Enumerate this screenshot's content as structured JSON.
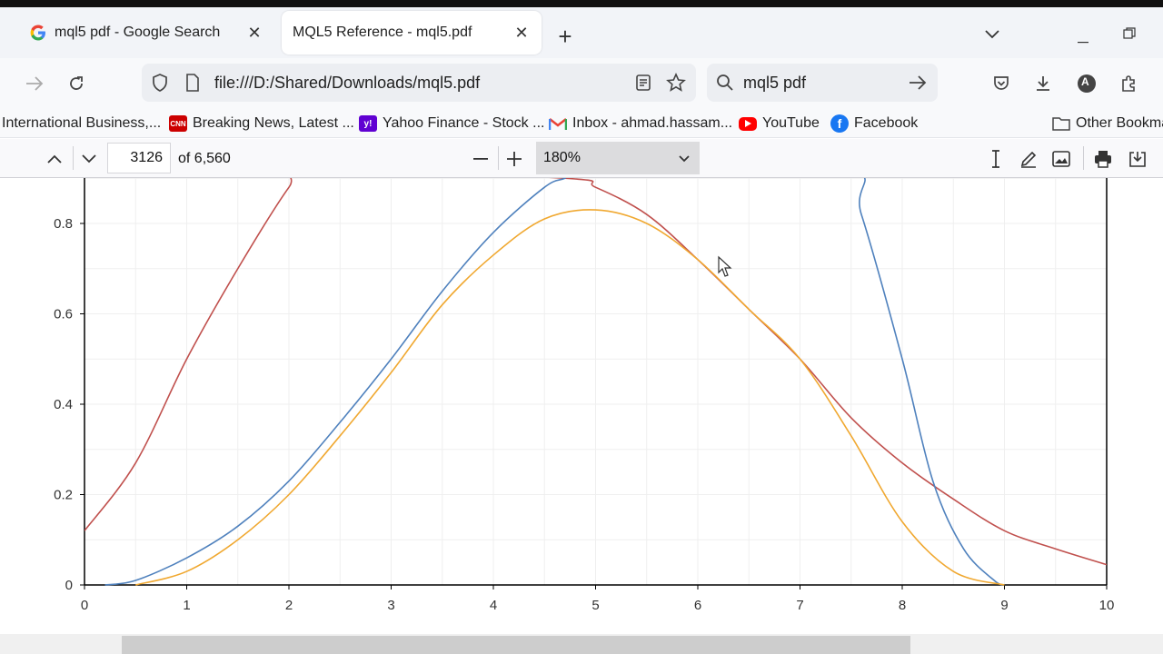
{
  "tabs": [
    {
      "title": "mql5 pdf - Google Search",
      "active": false,
      "icon": "google-icon"
    },
    {
      "title": "MQL5 Reference - mql5.pdf",
      "active": true,
      "icon": "none"
    }
  ],
  "nav": {
    "url": "file:///D:/Shared/Downloads/mql5.pdf",
    "search_text": "mql5 pdf",
    "profile_letter": "A"
  },
  "bookmarks": [
    {
      "label": "International Business,...",
      "icon": "none"
    },
    {
      "label": "Breaking News, Latest ...",
      "icon": "cnn-icon"
    },
    {
      "label": "Yahoo Finance - Stock ...",
      "icon": "yahoo-icon"
    },
    {
      "label": "Inbox - ahmad.hassam...",
      "icon": "gmail-icon"
    },
    {
      "label": "YouTube",
      "icon": "youtube-icon"
    },
    {
      "label": "Facebook",
      "icon": "facebook-icon"
    },
    {
      "label": "Other Bookma",
      "icon": "folder-icon"
    }
  ],
  "pdf_toolbar": {
    "page_number": "3126",
    "page_count": "of 6,560",
    "zoom": "180%"
  },
  "chart_data": {
    "type": "line",
    "xlim": [
      0,
      10
    ],
    "ylim": [
      0,
      0.9
    ],
    "x_ticks": [
      "0",
      "1",
      "2",
      "3",
      "4",
      "5",
      "6",
      "7",
      "8",
      "9",
      "10"
    ],
    "y_ticks": [
      "0",
      "0.2",
      "0.4",
      "0.6",
      "0.8"
    ],
    "grid": true,
    "colors": {
      "red": "#c0504d",
      "blue": "#4f81bd",
      "orange": "#f0a830"
    },
    "series": [
      {
        "color": "#c0504d",
        "x": [
          0,
          0.5,
          1,
          1.5,
          2,
          2.2,
          4.7,
          5,
          5.5,
          6,
          6.5,
          7,
          7.5,
          8,
          8.5,
          9,
          9.5,
          10
        ],
        "y": [
          0.12,
          0.27,
          0.5,
          0.7,
          0.88,
          0.92,
          0.9,
          0.88,
          0.82,
          0.72,
          0.61,
          0.5,
          0.37,
          0.27,
          0.19,
          0.12,
          0.08,
          0.045
        ]
      },
      {
        "color": "#4f81bd",
        "x": [
          0.2,
          0.5,
          1,
          1.5,
          2,
          2.5,
          3,
          3.5,
          4,
          4.5,
          4.7,
          4.9,
          7.4,
          7.6,
          8,
          8.3,
          8.6,
          8.9,
          9.0
        ],
        "y": [
          0,
          0.01,
          0.06,
          0.13,
          0.23,
          0.36,
          0.5,
          0.65,
          0.78,
          0.88,
          0.9,
          0.92,
          0.92,
          0.82,
          0.5,
          0.23,
          0.08,
          0.01,
          0
        ]
      },
      {
        "color": "#f0a830",
        "x": [
          0.5,
          1,
          1.5,
          2,
          2.5,
          3,
          3.5,
          4,
          4.5,
          5,
          5.5,
          6,
          6.5,
          7,
          7.5,
          8,
          8.5,
          9
        ],
        "y": [
          0,
          0.03,
          0.1,
          0.2,
          0.33,
          0.47,
          0.62,
          0.73,
          0.81,
          0.83,
          0.8,
          0.72,
          0.61,
          0.5,
          0.33,
          0.14,
          0.03,
          0
        ]
      }
    ]
  }
}
